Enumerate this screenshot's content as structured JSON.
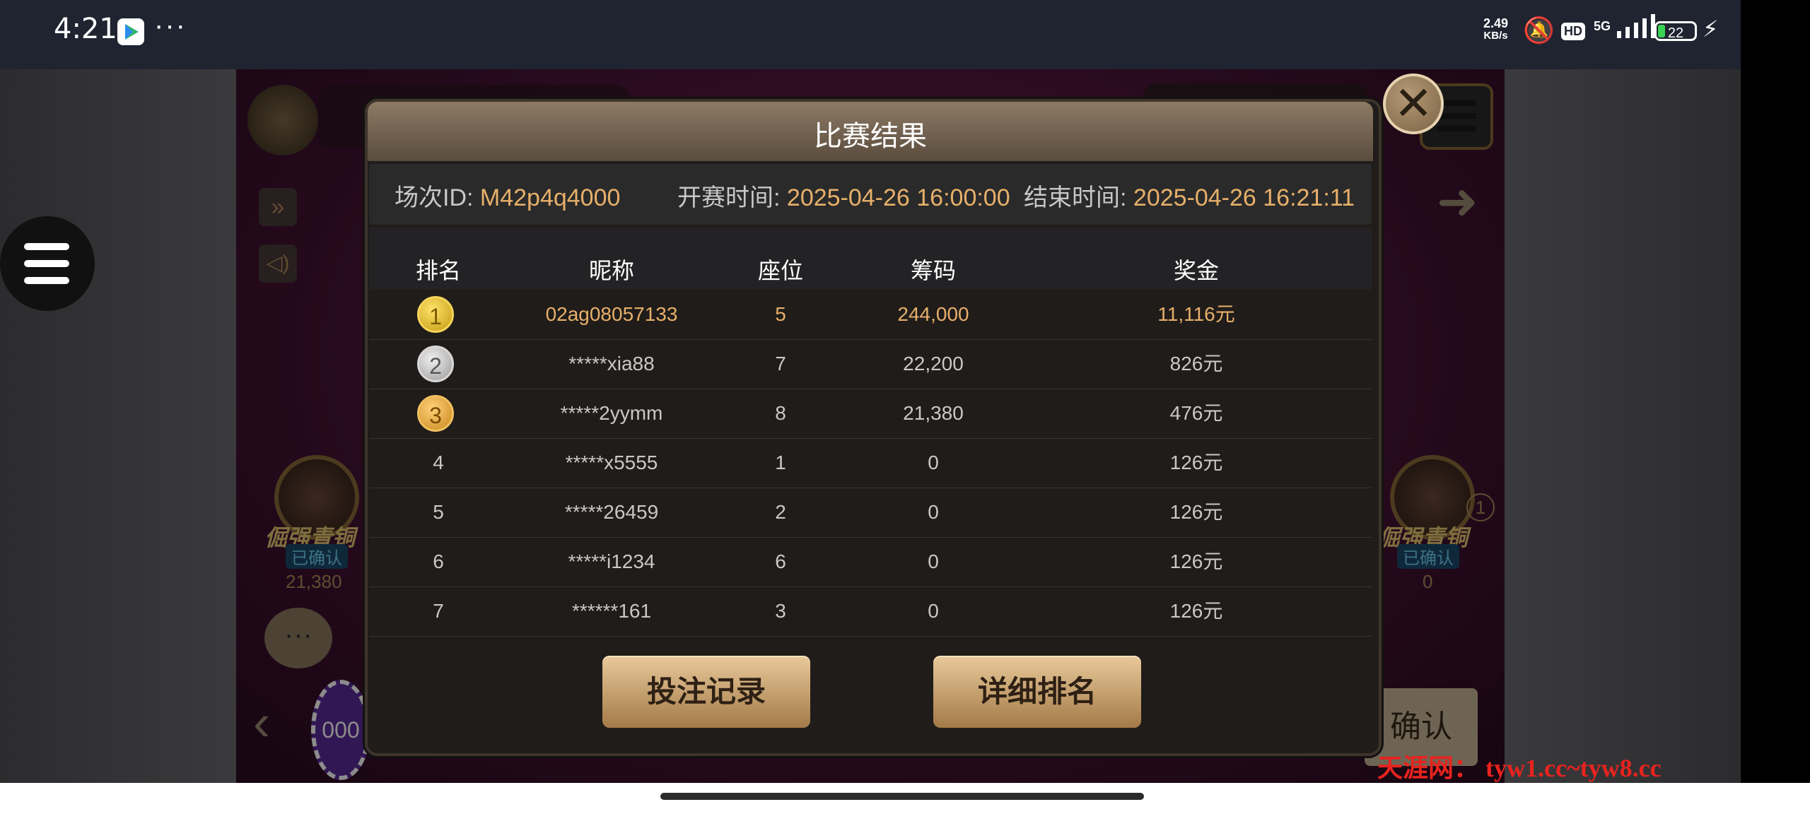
{
  "status_bar": {
    "time": "4:21",
    "more": "···",
    "net_speed_value": "2.49",
    "net_speed_unit": "KB/s",
    "hd_badge": "HD",
    "network": "5G",
    "battery": "22"
  },
  "game": {
    "chat_icon": "···",
    "confirm_label": "确认",
    "chip_value": "000",
    "player_left_name": "倔强青铜",
    "player_left_status": "已确认",
    "player_left_chips": "21,380",
    "player_right_name": "倔强青铜",
    "player_right_status": "已确认",
    "player_right_chips": "0",
    "player_right_seat": "1"
  },
  "dialog": {
    "title": "比赛结果",
    "close_icon": "close-icon",
    "session_label": "场次ID:",
    "session_id": "M42p4q4000",
    "start_label": "开赛时间:",
    "start_time": "2025-04-26 16:00:00",
    "end_label": "结束时间:",
    "end_time": "2025-04-26 16:21:11",
    "columns": [
      "排名",
      "昵称",
      "座位",
      "筹码",
      "奖金"
    ],
    "rows": [
      {
        "rank": "1",
        "nickname": "02ag08057133",
        "seat": "5",
        "chips": "244,000",
        "prize": "11,116元"
      },
      {
        "rank": "2",
        "nickname": "*****xia88",
        "seat": "7",
        "chips": "22,200",
        "prize": "826元"
      },
      {
        "rank": "3",
        "nickname": "*****2yymm",
        "seat": "8",
        "chips": "21,380",
        "prize": "476元"
      },
      {
        "rank": "4",
        "nickname": "*****x5555",
        "seat": "1",
        "chips": "0",
        "prize": "126元"
      },
      {
        "rank": "5",
        "nickname": "*****26459",
        "seat": "2",
        "chips": "0",
        "prize": "126元"
      },
      {
        "rank": "6",
        "nickname": "*****i1234",
        "seat": "6",
        "chips": "0",
        "prize": "126元"
      },
      {
        "rank": "7",
        "nickname": "******161",
        "seat": "3",
        "chips": "0",
        "prize": "126元"
      }
    ],
    "bet_record_label": "投注记录",
    "detail_rank_label": "详细排名"
  },
  "watermark": "天涯网： tyw1.cc~tyw8.cc",
  "colors": {
    "accent_gold": "#e7b06a",
    "dialog_bg": "#201c1a",
    "button_gold": "#c9a26e"
  }
}
